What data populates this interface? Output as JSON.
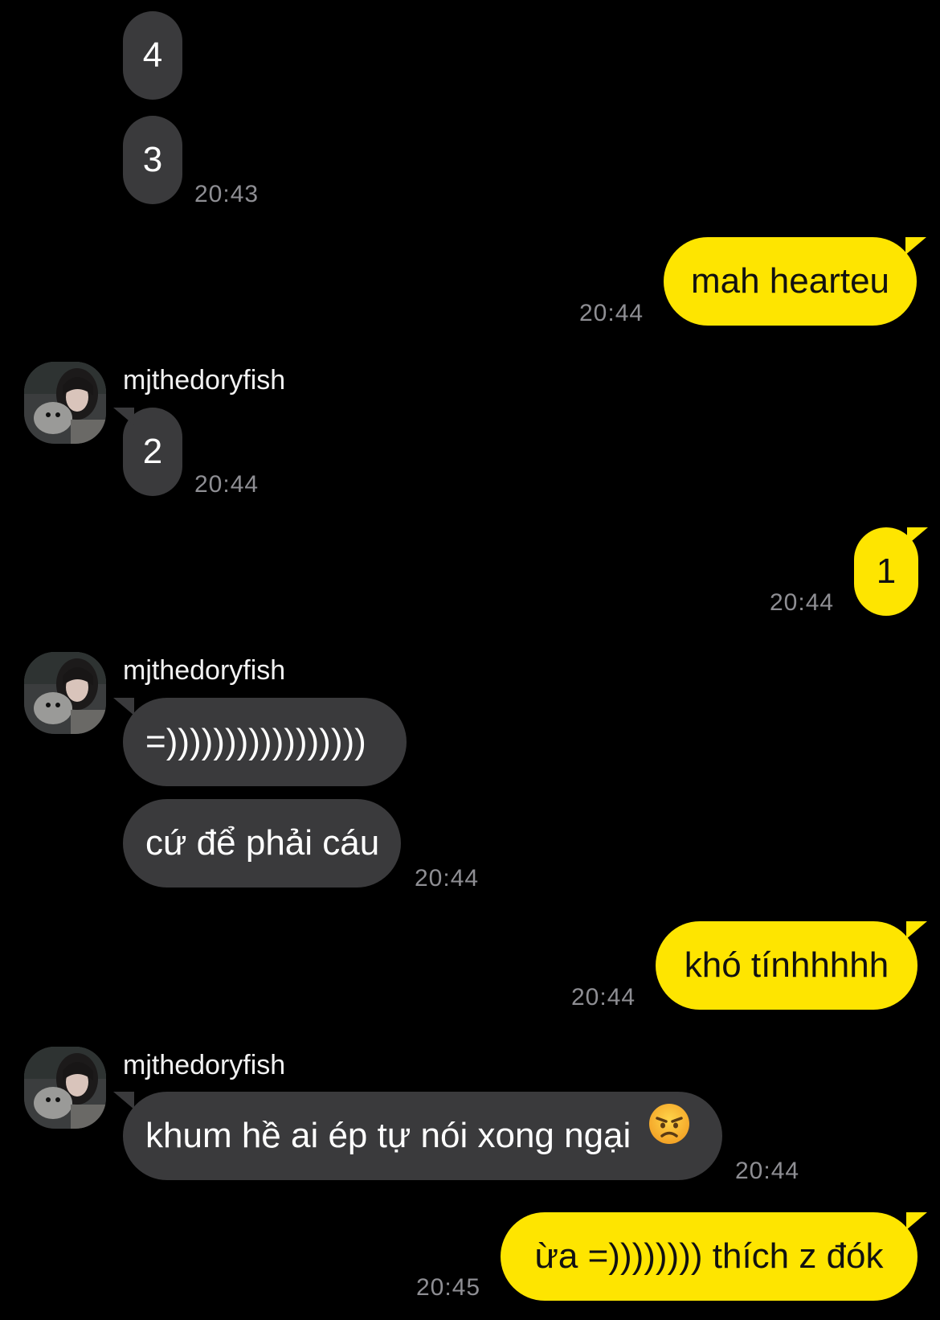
{
  "conversation": {
    "sender_name": "mjthedoryfish",
    "messages": [
      {
        "text": "4"
      },
      {
        "text": "3",
        "time": "20:43"
      },
      {
        "text": "mah hearteu",
        "time": "20:44"
      },
      {
        "text": "2",
        "time": "20:44"
      },
      {
        "text": "1",
        "time": "20:44"
      },
      {
        "text": "=)))))))))))))))))"
      },
      {
        "text": "cứ để phải cáu",
        "time": "20:44"
      },
      {
        "text": "khó tínhhhhh",
        "time": "20:44"
      },
      {
        "text": "khum hề ai ép tự nói xong ngại",
        "emoji": "angry-face-icon",
        "time": "20:44"
      },
      {
        "text": "ừa =)))))))) thích z đók",
        "time": "20:45"
      }
    ]
  },
  "colors": {
    "background": "#000000",
    "incoming_bubble": "#3a3a3c",
    "outgoing_bubble": "#fee500",
    "timestamp": "#8e8e93"
  }
}
